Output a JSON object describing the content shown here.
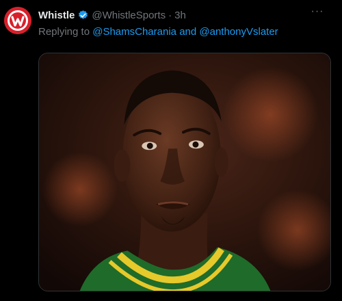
{
  "tweet": {
    "author_name": "Whistle",
    "handle": "@WhistleSports",
    "separator": "·",
    "time": "3h",
    "reply_prefix": "Replying to",
    "reply_mention_1": "@ShamsCharania",
    "reply_and": "and",
    "reply_mention_2": "@anthonyVslater",
    "more_label": "···"
  },
  "icons": {
    "avatar": "whistle-logo-icon",
    "verified": "verified-badge-icon",
    "more": "more-options-icon"
  },
  "colors": {
    "background": "#000000",
    "text_primary": "#e7e9ea",
    "text_secondary": "#71767b",
    "accent": "#1d9bf0",
    "avatar_red": "#d8202b"
  }
}
